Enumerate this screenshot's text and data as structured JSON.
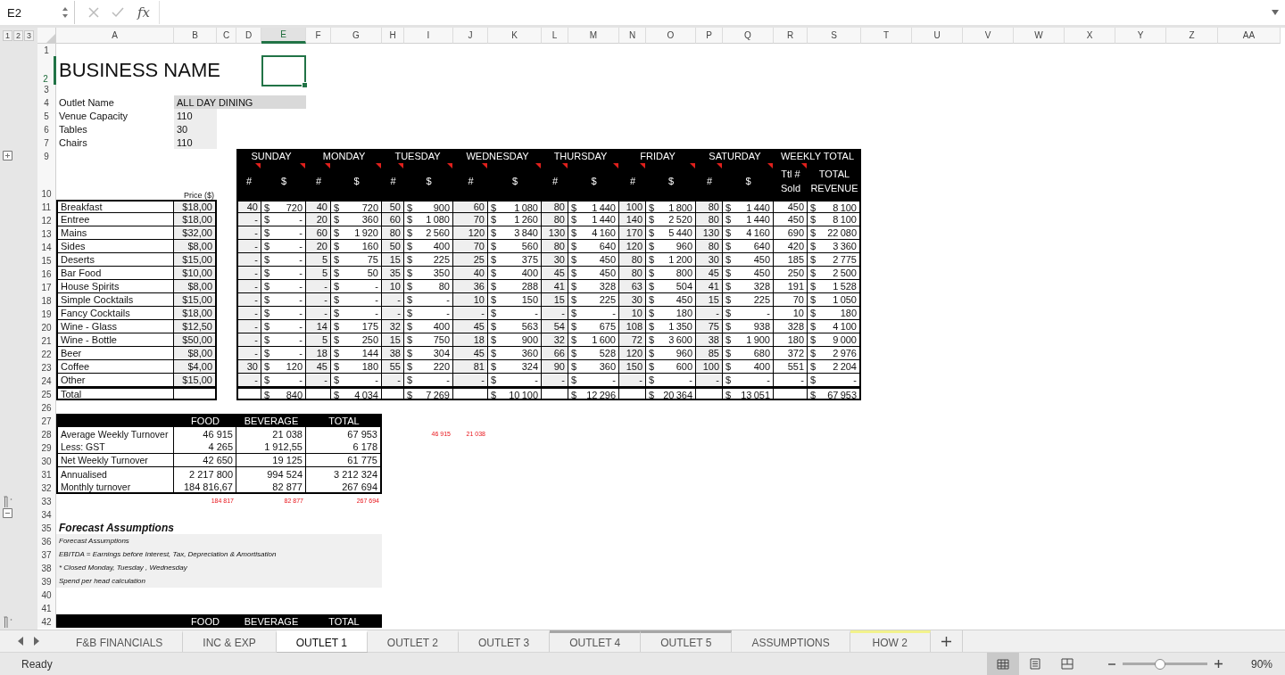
{
  "formula_bar": {
    "name_box": "E2",
    "function_label": "fx"
  },
  "outline_levels": [
    "1",
    "2",
    "3"
  ],
  "columns": [
    {
      "label": "A",
      "selected": false
    },
    {
      "label": "B",
      "selected": false
    },
    {
      "label": "C",
      "selected": false
    },
    {
      "label": "D",
      "selected": false
    },
    {
      "label": "E",
      "selected": true
    },
    {
      "label": "F",
      "selected": false
    },
    {
      "label": "G",
      "selected": false
    },
    {
      "label": "H",
      "selected": false
    },
    {
      "label": "I",
      "selected": false
    },
    {
      "label": "J",
      "selected": false
    },
    {
      "label": "K",
      "selected": false
    },
    {
      "label": "L",
      "selected": false
    },
    {
      "label": "M",
      "selected": false
    },
    {
      "label": "N",
      "selected": false
    },
    {
      "label": "O",
      "selected": false
    },
    {
      "label": "P",
      "selected": false
    },
    {
      "label": "Q",
      "selected": false
    },
    {
      "label": "R",
      "selected": false
    },
    {
      "label": "S",
      "selected": false
    },
    {
      "label": "T",
      "selected": false
    },
    {
      "label": "U",
      "selected": false
    },
    {
      "label": "V",
      "selected": false
    },
    {
      "label": "W",
      "selected": false
    },
    {
      "label": "X",
      "selected": false
    },
    {
      "label": "Y",
      "selected": false
    },
    {
      "label": "Z",
      "selected": false
    },
    {
      "label": "AA",
      "selected": false
    }
  ],
  "rows": [
    {
      "label": "1",
      "selected": false
    },
    {
      "label": "2",
      "selected": true
    },
    {
      "label": "3",
      "selected": false
    },
    {
      "label": "4",
      "selected": false
    },
    {
      "label": "5",
      "selected": false
    },
    {
      "label": "6",
      "selected": false
    },
    {
      "label": "7",
      "selected": false
    },
    {
      "label": "9",
      "selected": false
    },
    {
      "label": "10",
      "selected": false
    },
    {
      "label": "11",
      "selected": false
    },
    {
      "label": "12",
      "selected": false
    },
    {
      "label": "13",
      "selected": false
    },
    {
      "label": "14",
      "selected": false
    },
    {
      "label": "15",
      "selected": false
    },
    {
      "label": "16",
      "selected": false
    },
    {
      "label": "17",
      "selected": false
    },
    {
      "label": "18",
      "selected": false
    },
    {
      "label": "19",
      "selected": false
    },
    {
      "label": "20",
      "selected": false
    },
    {
      "label": "21",
      "selected": false
    },
    {
      "label": "22",
      "selected": false
    },
    {
      "label": "23",
      "selected": false
    },
    {
      "label": "24",
      "selected": false
    },
    {
      "label": "25",
      "selected": false
    },
    {
      "label": "26",
      "selected": false
    },
    {
      "label": "27",
      "selected": false
    },
    {
      "label": "28",
      "selected": false
    },
    {
      "label": "29",
      "selected": false
    },
    {
      "label": "30",
      "selected": false
    },
    {
      "label": "31",
      "selected": false
    },
    {
      "label": "32",
      "selected": false
    },
    {
      "label": "33",
      "selected": false
    },
    {
      "label": "34",
      "selected": false
    },
    {
      "label": "35",
      "selected": false
    },
    {
      "label": "36",
      "selected": false
    },
    {
      "label": "37",
      "selected": false
    },
    {
      "label": "38",
      "selected": false
    },
    {
      "label": "39",
      "selected": false
    },
    {
      "label": "40",
      "selected": false
    },
    {
      "label": "41",
      "selected": false
    },
    {
      "label": "42",
      "selected": false
    }
  ],
  "business_name": "BUSINESS NAME",
  "outlet_info": [
    {
      "label": "Outlet Name",
      "value": "ALL DAY DINING"
    },
    {
      "label": "Venue Capacity",
      "value": "110"
    },
    {
      "label": "Tables",
      "value": "30"
    },
    {
      "label": "Chairs",
      "value": "110"
    }
  ],
  "sales": {
    "days": [
      "SUNDAY",
      "MONDAY",
      "TUESDAY",
      "WEDNESDAY",
      "THURSDAY",
      "FRIDAY",
      "SATURDAY",
      "WEEKLY TOTAL"
    ],
    "price_header": "Price ($)",
    "subheaders": [
      {
        "label": "#",
        "comment": true
      },
      {
        "label": "$",
        "comment": true
      },
      {
        "label": "#",
        "comment": true
      },
      {
        "label": "$",
        "comment": true
      },
      {
        "label": "#",
        "comment": true
      },
      {
        "label": "$",
        "comment": true
      },
      {
        "label": "#",
        "comment": true
      },
      {
        "label": "$",
        "comment": true
      },
      {
        "label": "#",
        "comment": true
      },
      {
        "label": "$",
        "comment": true
      },
      {
        "label": "#",
        "comment": true
      },
      {
        "label": "$",
        "comment": true
      },
      {
        "label": "#",
        "comment": true
      },
      {
        "label": "$",
        "comment": true
      },
      {
        "label": "Ttl # Sold",
        "comment": true
      },
      {
        "label": "TOTAL REVENUE",
        "comment": false
      }
    ],
    "items": [
      {
        "name": "Breakfast",
        "price": "$18,00",
        "values": [
          "40",
          "$ 720",
          "40",
          "$ 720",
          "50",
          "$ 900",
          "60",
          "$ 1 080",
          "80",
          "$ 1 440",
          "100",
          "$ 1 800",
          "80",
          "$ 1 440",
          "450",
          "$ 8 100"
        ]
      },
      {
        "name": "Entree",
        "price": "$18,00",
        "values": [
          "-",
          "$ -",
          "20",
          "$ 360",
          "60",
          "$ 1 080",
          "70",
          "$ 1 260",
          "80",
          "$ 1 440",
          "140",
          "$ 2 520",
          "80",
          "$ 1 440",
          "450",
          "$ 8 100"
        ]
      },
      {
        "name": "Mains",
        "price": "$32,00",
        "values": [
          "-",
          "$ -",
          "60",
          "$ 1 920",
          "80",
          "$ 2 560",
          "120",
          "$ 3 840",
          "130",
          "$ 4 160",
          "170",
          "$ 5 440",
          "130",
          "$ 4 160",
          "690",
          "$ 22 080"
        ]
      },
      {
        "name": "Sides",
        "price": "$8,00",
        "values": [
          "-",
          "$ -",
          "20",
          "$ 160",
          "50",
          "$ 400",
          "70",
          "$ 560",
          "80",
          "$ 640",
          "120",
          "$ 960",
          "80",
          "$ 640",
          "420",
          "$ 3 360"
        ]
      },
      {
        "name": "Deserts",
        "price": "$15,00",
        "values": [
          "-",
          "$ -",
          "5",
          "$ 75",
          "15",
          "$ 225",
          "25",
          "$ 375",
          "30",
          "$ 450",
          "80",
          "$ 1 200",
          "30",
          "$ 450",
          "185",
          "$ 2 775"
        ]
      },
      {
        "name": "Bar Food",
        "price": "$10,00",
        "values": [
          "-",
          "$ -",
          "5",
          "$ 50",
          "35",
          "$ 350",
          "40",
          "$ 400",
          "45",
          "$ 450",
          "80",
          "$ 800",
          "45",
          "$ 450",
          "250",
          "$ 2 500"
        ]
      },
      {
        "name": "House Spirits",
        "price": "$8,00",
        "values": [
          "-",
          "$ -",
          "-",
          "$ -",
          "10",
          "$ 80",
          "36",
          "$ 288",
          "41",
          "$ 328",
          "63",
          "$ 504",
          "41",
          "$ 328",
          "191",
          "$ 1 528"
        ]
      },
      {
        "name": "Simple Cocktails",
        "price": "$15,00",
        "values": [
          "-",
          "$ -",
          "-",
          "$ -",
          "-",
          "$ -",
          "10",
          "$ 150",
          "15",
          "$ 225",
          "30",
          "$ 450",
          "15",
          "$ 225",
          "70",
          "$ 1 050"
        ]
      },
      {
        "name": "Fancy Cocktails",
        "price": "$18,00",
        "values": [
          "-",
          "$ -",
          "-",
          "$ -",
          "-",
          "$ -",
          "-",
          "$ -",
          "-",
          "$ -",
          "10",
          "$ 180",
          "-",
          "$ -",
          "10",
          "$ 180"
        ]
      },
      {
        "name": "Wine - Glass",
        "price": "$12,50",
        "values": [
          "-",
          "$ -",
          "14",
          "$ 175",
          "32",
          "$ 400",
          "45",
          "$ 563",
          "54",
          "$ 675",
          "108",
          "$ 1 350",
          "75",
          "$ 938",
          "328",
          "$ 4 100"
        ]
      },
      {
        "name": "Wine - Bottle",
        "price": "$50,00",
        "values": [
          "-",
          "$ -",
          "5",
          "$ 250",
          "15",
          "$ 750",
          "18",
          "$ 900",
          "32",
          "$ 1 600",
          "72",
          "$ 3 600",
          "38",
          "$ 1 900",
          "180",
          "$ 9 000"
        ]
      },
      {
        "name": "Beer",
        "price": "$8,00",
        "values": [
          "-",
          "$ -",
          "18",
          "$ 144",
          "38",
          "$ 304",
          "45",
          "$ 360",
          "66",
          "$ 528",
          "120",
          "$ 960",
          "85",
          "$ 680",
          "372",
          "$ 2 976"
        ]
      },
      {
        "name": "Coffee",
        "price": "$4,00",
        "values": [
          "30",
          "$ 120",
          "45",
          "$ 180",
          "55",
          "$ 220",
          "81",
          "$ 324",
          "90",
          "$ 360",
          "150",
          "$ 600",
          "100",
          "$ 400",
          "551",
          "$ 2 204"
        ]
      },
      {
        "name": "Other",
        "price": "$15,00",
        "values": [
          "-",
          "$ -",
          "-",
          "$ -",
          "-",
          "$ -",
          "-",
          "$ -",
          "-",
          "$ -",
          "-",
          "$ -",
          "-",
          "$ -",
          "-",
          "$ -"
        ]
      }
    ],
    "total": {
      "label": "Total",
      "values": [
        "$ 840",
        "$ 4 034",
        "$ 7 269",
        "$ 10 100",
        "$ 12 296",
        "$ 20 364",
        "$ 13 051",
        "$ 67 953"
      ]
    }
  },
  "summary": {
    "headers": [
      "FOOD",
      "BEVERAGE",
      "TOTAL"
    ],
    "rows": [
      {
        "label": "Average Weekly Turnover",
        "values": [
          "46 915",
          "21 038",
          "67 953"
        ],
        "rule_below": false
      },
      {
        "label": "Less: GST",
        "values": [
          "4 265",
          "1 912,55",
          "6 178"
        ],
        "rule_below": true
      },
      {
        "label": "Net Weekly Turnover",
        "values": [
          "42 650",
          "19 125",
          "61 775"
        ],
        "rule_below": true
      },
      {
        "label": "Annualised",
        "values": [
          "2 217 800",
          "994 524",
          "3 212 324"
        ],
        "rule_below": false
      },
      {
        "label": "Monthly turnover",
        "values": [
          "184 816,67",
          "82 877",
          "267 694"
        ],
        "rule_below": true
      }
    ],
    "side_checks": [
      "46 915",
      "21 038"
    ],
    "checks": [
      "184 817",
      "82 877",
      "267 694"
    ]
  },
  "assumptions": {
    "title": "Forecast Assumptions",
    "notes": [
      "Forecast Assumptions",
      "EBITDA = Earnings before Interest, Tax, Depreciation & Amortisation",
      "* Closed Monday, Tuesday , Wednesday",
      "Spend per head calculation"
    ]
  },
  "summary_2": {
    "headers": [
      "FOOD",
      "BEVERAGE",
      "TOTAL"
    ]
  },
  "sheet_tabs": [
    {
      "label": "F&B FINANCIALS",
      "selected": false
    },
    {
      "label": "INC & EXP",
      "selected": false
    },
    {
      "label": "OUTLET 1",
      "selected": true
    },
    {
      "label": "OUTLET 2",
      "selected": false
    },
    {
      "label": "OUTLET 3",
      "selected": false
    },
    {
      "label": "OUTLET 4",
      "selected": false,
      "color": "#a6a6a6"
    },
    {
      "label": "OUTLET 5",
      "selected": false,
      "color": "#a6a6a6"
    },
    {
      "label": "ASSUMPTIONS",
      "selected": false
    },
    {
      "label": "HOW 2",
      "selected": false,
      "color": "#f2f28c"
    }
  ],
  "status_bar": {
    "status": "Ready",
    "views": [
      {
        "kind": "normal",
        "selected": true
      },
      {
        "kind": "page_layout",
        "selected": false
      },
      {
        "kind": "page_break",
        "selected": false
      }
    ],
    "zoom": {
      "level": 0.44,
      "label": "90%"
    }
  }
}
